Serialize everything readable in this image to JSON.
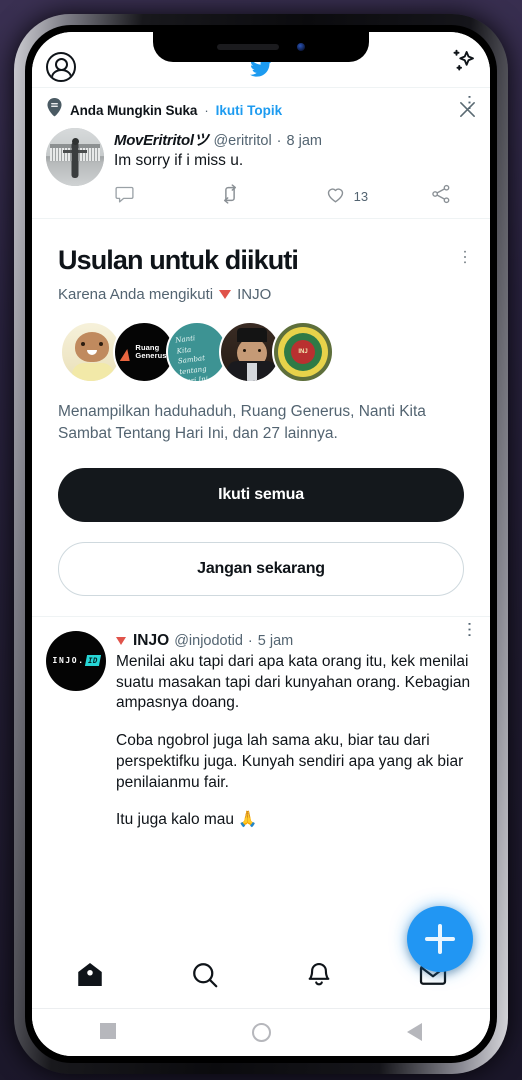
{
  "app": {
    "name": "Twitter",
    "header": {
      "avatar_icon": "account-circle-icon",
      "logo_icon": "twitter-bird-icon",
      "sparkle_icon": "sparkle-icon"
    }
  },
  "promoted_tweet": {
    "module_icon": "topic-pin-icon",
    "module_label": "Anda Mungkin Suka",
    "separator": "·",
    "module_link": "Ikuti Topik",
    "close_icon": "close-icon",
    "more_icon": "more-options-icon",
    "author": {
      "display_name": "MovEritritolツ",
      "handle": "@eritritol",
      "separator": "·",
      "time": "8 jam",
      "avatar_alt": "grayscale-photo-person-standing"
    },
    "text": "Im sorry if i miss u.",
    "actions": {
      "reply_icon": "reply-icon",
      "retweet_icon": "retweet-icon",
      "like_icon": "like-icon",
      "like_count": "13",
      "share_icon": "share-icon"
    }
  },
  "suggestion_module": {
    "title": "Usulan untuk diikuti",
    "reason_prefix": "Karena Anda mengikuti",
    "reason_account": "INJO",
    "verified_icon": "triangle-badge-icon",
    "more_icon": "more-options-icon",
    "avatars": [
      {
        "name": "haduhaduh",
        "alt": "toddler-photo"
      },
      {
        "name": "Ruang Generus",
        "line1": "Ruang",
        "line2": "Generus",
        "alt": "ruang-generus-logo"
      },
      {
        "name": "Nanti Kita Sambat Tentang Hari Ini",
        "hand1": "Nanti",
        "hand2": "Kita Sambat",
        "hand3": "tentang",
        "hand4": "Hari Ini",
        "alt": "handwritten-teal-logo"
      },
      {
        "name": "male-person",
        "alt": "man-with-peci-portrait"
      },
      {
        "name": "organization",
        "badge": "INJ",
        "alt": "green-gold-emblem"
      }
    ],
    "description": "Menampilkan haduhaduh, Ruang Generus, Nanti Kita Sambat Tentang Hari Ini, dan 27 lainnya.",
    "follow_all_label": "Ikuti semua",
    "not_now_label": "Jangan sekarang"
  },
  "injo_tweet": {
    "verified_icon": "triangle-badge-icon",
    "display_name": "INJO",
    "handle": "@injodotid",
    "separator": "·",
    "time": "5 jam",
    "more_icon": "more-options-icon",
    "avatar": {
      "word": "INJO.",
      "badge": "ID"
    },
    "paragraph_1": "Menilai aku tapi dari apa kata orang itu, kek menilai suatu masakan tapi dari kunyahan orang. Kebagian ampasnya doang.",
    "paragraph_2": "Coba ngobrol juga lah sama aku, biar tau dari perspektifku juga. Kunyah sendiri apa yang ak biar penilaianmu fair.",
    "paragraph_3": "Itu juga kalo mau 🙏"
  },
  "compose_fab": {
    "icon": "plus-icon",
    "color": "#2196f3"
  },
  "tab_bar": {
    "items": [
      {
        "icon": "home-icon",
        "label": "Beranda",
        "active": true
      },
      {
        "icon": "search-icon",
        "label": "Telusuri",
        "active": false
      },
      {
        "icon": "bell-icon",
        "label": "Notifikasi",
        "active": false
      },
      {
        "icon": "mail-icon",
        "label": "Pesan",
        "active": false
      }
    ]
  },
  "system_nav": {
    "recents_icon": "square-icon",
    "home_icon": "circle-icon",
    "back_icon": "triangle-back-icon"
  },
  "colors": {
    "accent": "#1d9bf0",
    "fab": "#2196f3",
    "text_primary": "#0f1419",
    "text_secondary": "#536471",
    "verified_triangle": "#e0534a",
    "button_dark": "#14181c"
  }
}
